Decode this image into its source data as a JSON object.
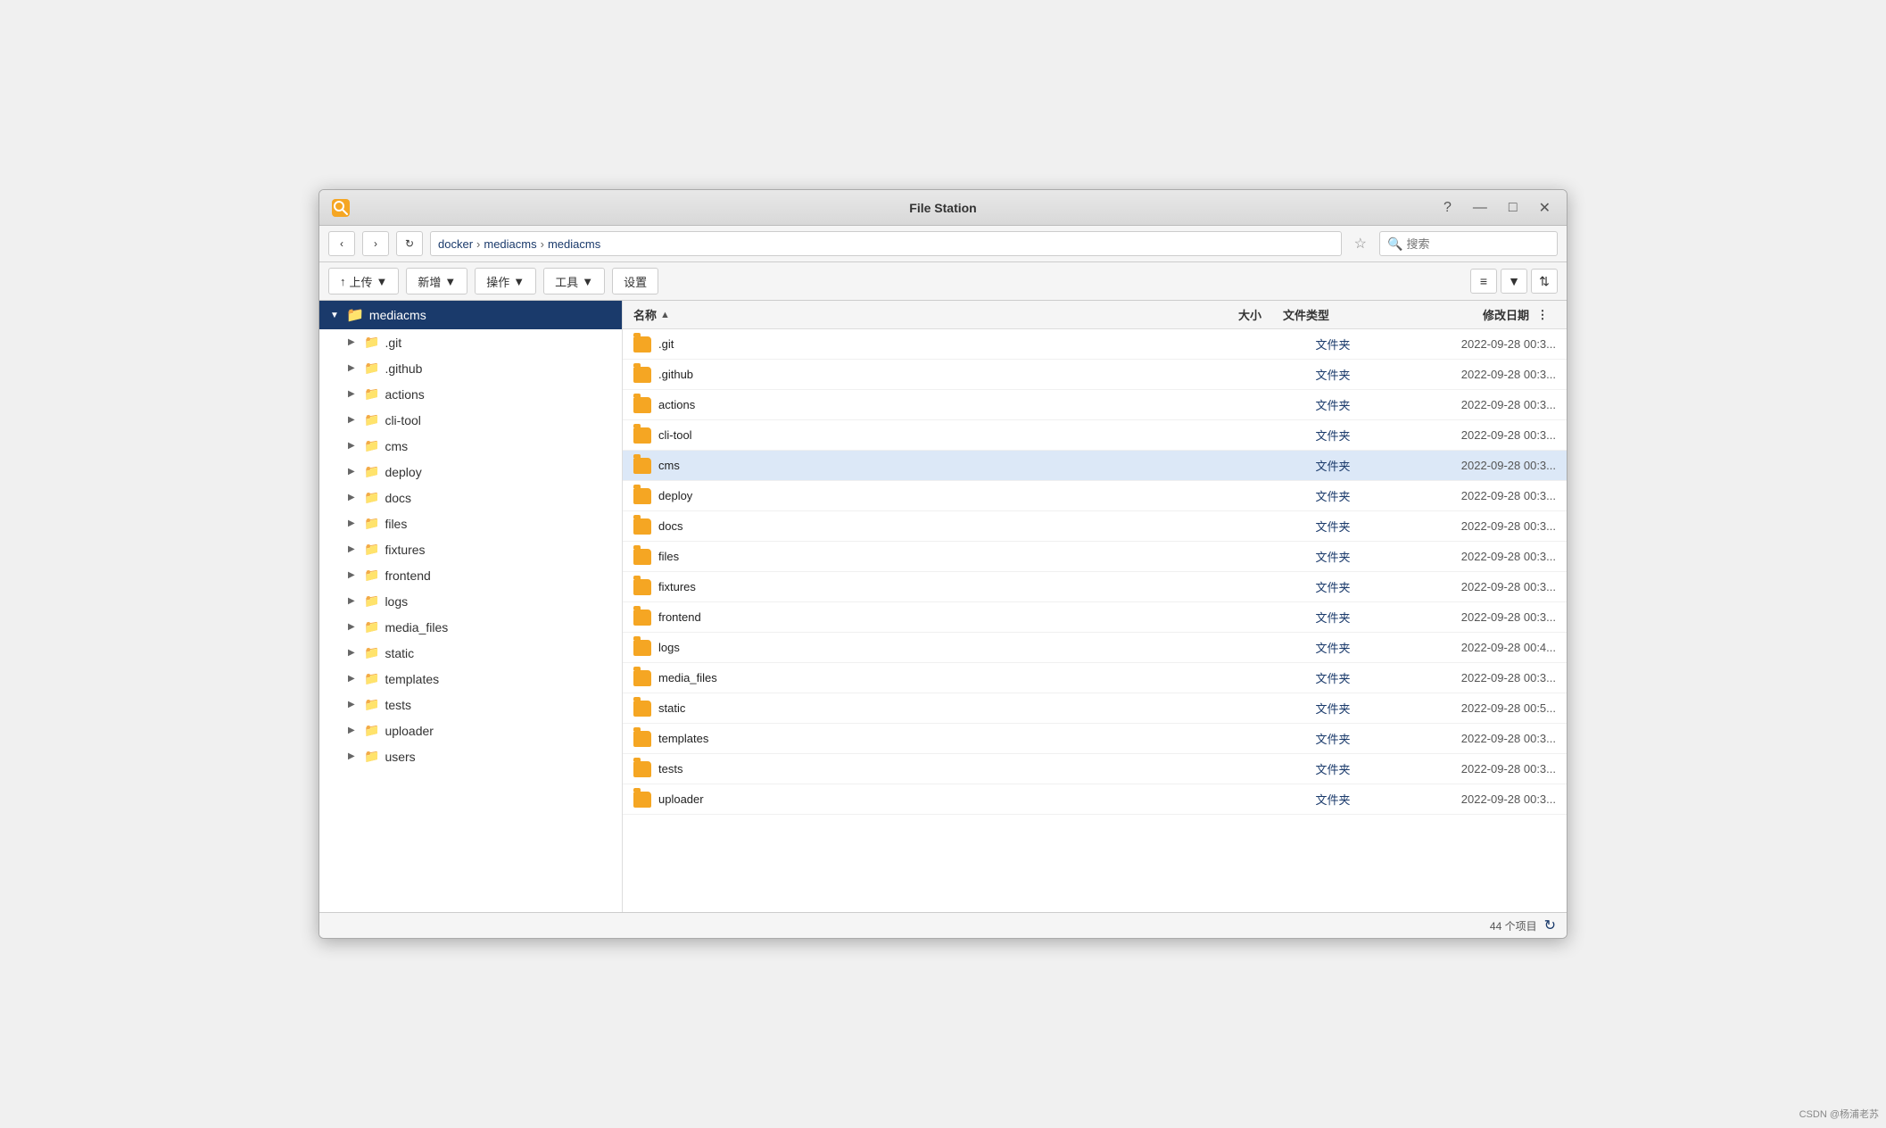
{
  "window": {
    "title": "File Station"
  },
  "titlebar": {
    "title": "File Station",
    "help_btn": "?",
    "min_btn": "—",
    "max_btn": "□",
    "close_btn": "✕"
  },
  "toolbar": {
    "back_btn": "‹",
    "forward_btn": "›",
    "refresh_btn": "↻",
    "address": {
      "parts": [
        "docker",
        "mediacms",
        "mediacms"
      ]
    },
    "star_btn": "☆",
    "search_placeholder": "搜索"
  },
  "actionbar": {
    "upload_btn": "上传",
    "new_btn": "新增",
    "action_btn": "操作",
    "tools_btn": "工具",
    "settings_btn": "设置",
    "view_list_btn": "≡",
    "view_grid_btn": "⊞",
    "sort_btn": "⇅"
  },
  "sidebar": {
    "root": "mediacms",
    "items": [
      {
        "name": ".git",
        "indent": 1
      },
      {
        "name": ".github",
        "indent": 1
      },
      {
        "name": "actions",
        "indent": 1
      },
      {
        "name": "cli-tool",
        "indent": 1
      },
      {
        "name": "cms",
        "indent": 1
      },
      {
        "name": "deploy",
        "indent": 1
      },
      {
        "name": "docs",
        "indent": 1
      },
      {
        "name": "files",
        "indent": 1
      },
      {
        "name": "fixtures",
        "indent": 1
      },
      {
        "name": "frontend",
        "indent": 1
      },
      {
        "name": "logs",
        "indent": 1
      },
      {
        "name": "media_files",
        "indent": 1
      },
      {
        "name": "static",
        "indent": 1
      },
      {
        "name": "templates",
        "indent": 1
      },
      {
        "name": "tests",
        "indent": 1
      },
      {
        "name": "uploader",
        "indent": 1
      },
      {
        "name": "users",
        "indent": 1
      }
    ]
  },
  "filelist": {
    "headers": {
      "name": "名称",
      "sort_icon": "▲",
      "size": "大小",
      "type": "文件类型",
      "date": "修改日期",
      "more": "⋮"
    },
    "rows": [
      {
        "name": ".git",
        "size": "",
        "type": "文件夹",
        "date": "2022-09-28 00:3..."
      },
      {
        "name": ".github",
        "size": "",
        "type": "文件夹",
        "date": "2022-09-28 00:3..."
      },
      {
        "name": "actions",
        "size": "",
        "type": "文件夹",
        "date": "2022-09-28 00:3..."
      },
      {
        "name": "cli-tool",
        "size": "",
        "type": "文件夹",
        "date": "2022-09-28 00:3..."
      },
      {
        "name": "cms",
        "size": "",
        "type": "文件夹",
        "date": "2022-09-28 00:3...",
        "selected": true
      },
      {
        "name": "deploy",
        "size": "",
        "type": "文件夹",
        "date": "2022-09-28 00:3..."
      },
      {
        "name": "docs",
        "size": "",
        "type": "文件夹",
        "date": "2022-09-28 00:3..."
      },
      {
        "name": "files",
        "size": "",
        "type": "文件夹",
        "date": "2022-09-28 00:3..."
      },
      {
        "name": "fixtures",
        "size": "",
        "type": "文件夹",
        "date": "2022-09-28 00:3..."
      },
      {
        "name": "frontend",
        "size": "",
        "type": "文件夹",
        "date": "2022-09-28 00:3..."
      },
      {
        "name": "logs",
        "size": "",
        "type": "文件夹",
        "date": "2022-09-28 00:4..."
      },
      {
        "name": "media_files",
        "size": "",
        "type": "文件夹",
        "date": "2022-09-28 00:3..."
      },
      {
        "name": "static",
        "size": "",
        "type": "文件夹",
        "date": "2022-09-28 00:5..."
      },
      {
        "name": "templates",
        "size": "",
        "type": "文件夹",
        "date": "2022-09-28 00:3..."
      },
      {
        "name": "tests",
        "size": "",
        "type": "文件夹",
        "date": "2022-09-28 00:3..."
      },
      {
        "name": "uploader",
        "size": "",
        "type": "文件夹",
        "date": "2022-09-28 00:3..."
      }
    ]
  },
  "statusbar": {
    "count_label": "44 个项目",
    "refresh_icon": "↻"
  },
  "watermark": {
    "text": "CSDN @杨浦老苏"
  }
}
